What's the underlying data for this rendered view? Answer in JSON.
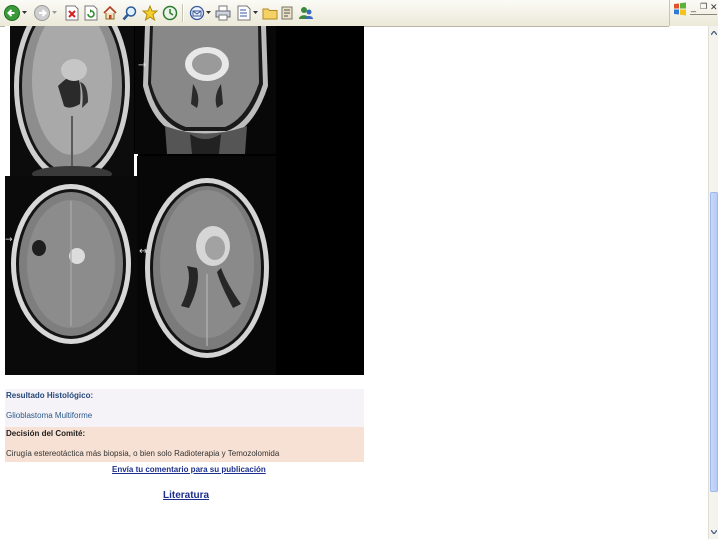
{
  "toolbar": {
    "buttons": [
      {
        "name": "back",
        "icon": "back-arrow-icon"
      },
      {
        "name": "forward",
        "icon": "forward-arrow-icon"
      },
      {
        "name": "stop",
        "icon": "stop-icon"
      },
      {
        "name": "refresh",
        "icon": "refresh-icon"
      },
      {
        "name": "home",
        "icon": "home-icon"
      },
      {
        "name": "search",
        "icon": "search-icon"
      },
      {
        "name": "favorites",
        "icon": "favorites-star-icon"
      },
      {
        "name": "history",
        "icon": "history-icon"
      },
      {
        "name": "mail",
        "icon": "mail-icon"
      },
      {
        "name": "print",
        "icon": "print-icon"
      },
      {
        "name": "edit",
        "icon": "edit-document-icon"
      },
      {
        "name": "folder",
        "icon": "folder-icon"
      },
      {
        "name": "research",
        "icon": "research-icon"
      },
      {
        "name": "messenger",
        "icon": "messenger-icon"
      }
    ],
    "accent": "#2f8f2f"
  },
  "content": {
    "resultado_label": "Resultado Histológico:",
    "resultado_value": "Glioblastoma Multiforme",
    "decision_label": "Decisión del Comité:",
    "decision_value": "Cirugía estereotáctica más biopsia, o bien solo Radioterapia y Temozolomida",
    "enviar_link": "Envía tu comentario para su publicación",
    "literatura_link": "Literatura"
  },
  "colors": {
    "link": "#1c2f8c",
    "section_hist_bg": "#f5f2f8",
    "section_comite_bg": "#f7e1d4",
    "label_blue": "#26487a"
  }
}
